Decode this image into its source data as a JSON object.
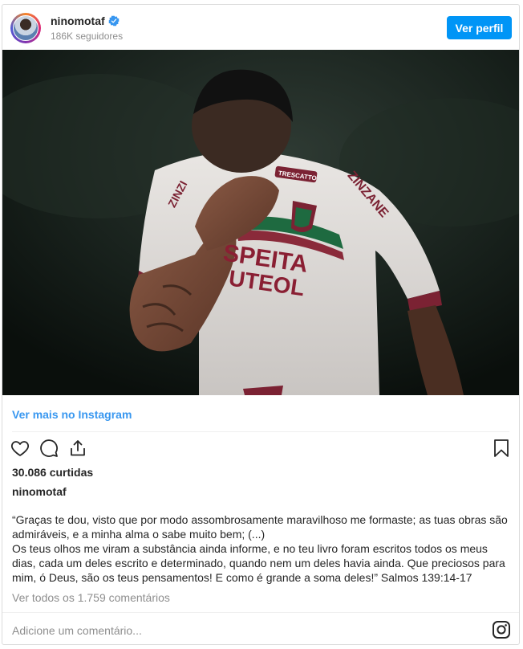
{
  "header": {
    "username": "ninomotaf",
    "followers": "186K seguidores",
    "view_profile_label": "Ver perfil"
  },
  "post": {
    "view_more_label": "Ver mais no Instagram",
    "likes": "30.086 curtidas",
    "caption_user": "ninomotaf",
    "caption": "“Graças te dou, visto que por modo assombrosamente maravilhoso me formaste; as tuas obras são admiráveis, e a minha alma o sabe muito bem; (...)\nOs teus olhos me viram a substância ainda informe, e no teu livro foram escritos todos os meus dias, cada um deles escrito e determinado, quando nem um deles havia ainda. Que preciosos para mim, ó Deus, são os teus pensamentos! E como é grande a soma deles!” Salmos 139:14-17",
    "view_comments": "Ver todos os 1.759 comentários"
  },
  "photo": {
    "jersey_front": "SPEITA",
    "jersey_sponsor": "UTEOL",
    "jersey_sleeve": "ZINZANE",
    "jersey_left": "ZINZI",
    "jersey_patch": "TRESCATTO"
  },
  "footer": {
    "comment_placeholder": "Adicione um comentário..."
  },
  "icons": {
    "verified": "verified-badge-icon",
    "like": "heart-icon",
    "comment": "comment-bubble-icon",
    "share": "share-icon",
    "save": "bookmark-icon",
    "brand": "instagram-icon"
  },
  "colors": {
    "accent": "#0095f6",
    "link": "#3897f0",
    "muted": "#8e8e8e",
    "text": "#262626"
  }
}
